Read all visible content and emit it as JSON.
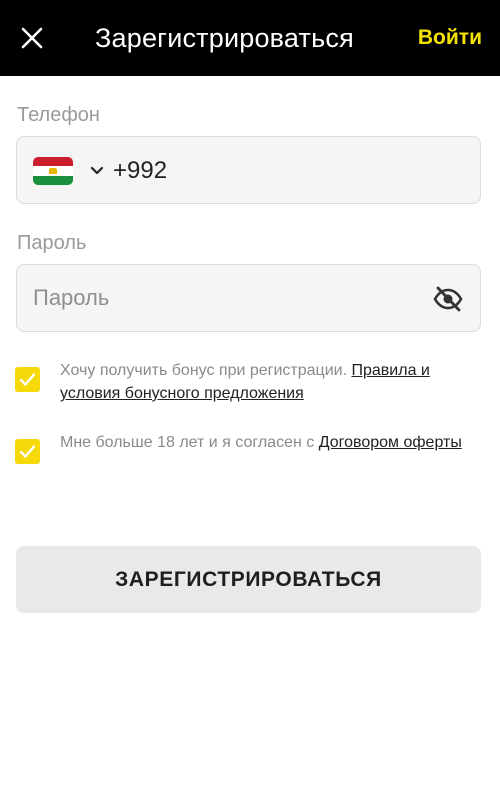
{
  "header": {
    "close_icon": "close-icon",
    "title": "Зарегистрироваться",
    "login_label": "Войти"
  },
  "phone": {
    "label": "Телефон",
    "country_flag": "tajikistan-flag",
    "country_code": "+992"
  },
  "password": {
    "label": "Пароль",
    "placeholder": "Пароль",
    "toggle_icon": "eye-off-icon"
  },
  "consents": [
    {
      "checked": true,
      "text": "Хочу получить бонус при регистрации.",
      "link": "Правила и условия бонусного предложения"
    },
    {
      "checked": true,
      "text": "Мне больше 18 лет и я согласен с",
      "link": "Договором оферты"
    }
  ],
  "register_button": {
    "label": "ЗАРЕГИСТРИРОВАТЬСЯ"
  },
  "colors": {
    "header_bg": "#000000",
    "accent": "#f5e100",
    "checkbox": "#f5d90a",
    "button_bg": "#e9e9e9"
  }
}
